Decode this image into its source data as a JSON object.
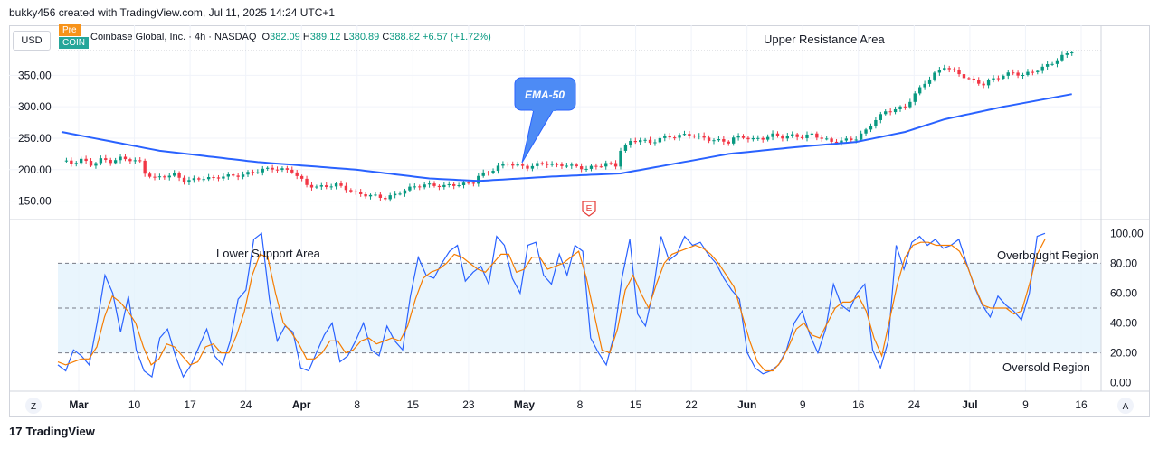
{
  "header": {
    "credit": "bukky456 created with TradingView.com, Jul 11, 2025 14:24 UTC+1"
  },
  "toolbar": {
    "currency": "USD",
    "pre_badge": "Pre",
    "coin_badge": "COIN",
    "scale_z": "Z",
    "scale_a": "A"
  },
  "legend": {
    "name": "Coinbase Global, Inc. · 4h · NASDAQ",
    "o_label": "O",
    "o_value": "382.09",
    "h_label": "H",
    "h_value": "389.12",
    "l_label": "L",
    "l_value": "380.89",
    "c_label": "C",
    "c_value": "388.82",
    "change": "+6.57 (+1.72%)"
  },
  "annotations": {
    "upper_resistance": "Upper Resistance Area",
    "ema_callout": "EMA-50",
    "lower_support": "Lower Support Area",
    "overbought": "Overbought Region",
    "oversold": "Oversold Region",
    "earnings_marker": "E"
  },
  "footer": {
    "brand": "TradingView",
    "logo": "17"
  },
  "colors": {
    "up": "#089981",
    "down": "#f23645",
    "ema": "#2962ff",
    "k_line": "#2962ff",
    "d_line": "#f57c00",
    "band": "#e3f2fd",
    "callout": "#4d8bf5"
  },
  "chart_data": [
    {
      "type": "candlestick",
      "title": "",
      "x_ticks": [
        "Mar",
        "10",
        "17",
        "24",
        "Apr",
        "8",
        "15",
        "23",
        "May",
        "8",
        "15",
        "22",
        "Jun",
        "9",
        "16",
        "24",
        "Jul",
        "9",
        "16"
      ],
      "y_ticks": [
        "150.00",
        "200.00",
        "250.00",
        "300.00",
        "350.00"
      ],
      "ylim": [
        125,
        395
      ],
      "close_series": [
        [
          0,
          214
        ],
        [
          2,
          210
        ],
        [
          4,
          216
        ],
        [
          6,
          208
        ],
        [
          8,
          216
        ],
        [
          10,
          213
        ],
        [
          12,
          218
        ],
        [
          14,
          216
        ],
        [
          16,
          212
        ],
        [
          17,
          195
        ],
        [
          19,
          186
        ],
        [
          21,
          190
        ],
        [
          23,
          192
        ],
        [
          25,
          182
        ],
        [
          27,
          184
        ],
        [
          29,
          187
        ],
        [
          31,
          186
        ],
        [
          33,
          190
        ],
        [
          35,
          190
        ],
        [
          37,
          192
        ],
        [
          39,
          196
        ],
        [
          41,
          200
        ],
        [
          43,
          202
        ],
        [
          45,
          200
        ],
        [
          47,
          198
        ],
        [
          48,
          190
        ],
        [
          50,
          176
        ],
        [
          52,
          172
        ],
        [
          54,
          174
        ],
        [
          56,
          176
        ],
        [
          58,
          170
        ],
        [
          60,
          162
        ],
        [
          62,
          160
        ],
        [
          64,
          158
        ],
        [
          66,
          155
        ],
        [
          68,
          160
        ],
        [
          70,
          168
        ],
        [
          72,
          173
        ],
        [
          74,
          176
        ],
        [
          76,
          175
        ],
        [
          78,
          174
        ],
        [
          80,
          176
        ],
        [
          82,
          177
        ],
        [
          84,
          180
        ],
        [
          85,
          190
        ],
        [
          87,
          196
        ],
        [
          89,
          205
        ],
        [
          91,
          210
        ],
        [
          93,
          206
        ],
        [
          95,
          204
        ],
        [
          97,
          208
        ],
        [
          99,
          210
        ],
        [
          101,
          206
        ],
        [
          103,
          208
        ],
        [
          105,
          204
        ],
        [
          107,
          202
        ],
        [
          109,
          205
        ],
        [
          111,
          210
        ],
        [
          113,
          206
        ],
        [
          114,
          232
        ],
        [
          116,
          244
        ],
        [
          118,
          248
        ],
        [
          120,
          242
        ],
        [
          122,
          250
        ],
        [
          124,
          252
        ],
        [
          126,
          254
        ],
        [
          128,
          256
        ],
        [
          130,
          252
        ],
        [
          132,
          248
        ],
        [
          134,
          246
        ],
        [
          136,
          244
        ],
        [
          137,
          250
        ],
        [
          139,
          252
        ],
        [
          141,
          248
        ],
        [
          143,
          250
        ],
        [
          145,
          255
        ],
        [
          147,
          252
        ],
        [
          149,
          254
        ],
        [
          151,
          252
        ],
        [
          153,
          256
        ],
        [
          155,
          250
        ],
        [
          157,
          244
        ],
        [
          159,
          246
        ],
        [
          161,
          248
        ],
        [
          162,
          250
        ],
        [
          164,
          262
        ],
        [
          166,
          280
        ],
        [
          168,
          292
        ],
        [
          170,
          296
        ],
        [
          172,
          300
        ],
        [
          174,
          320
        ],
        [
          176,
          338
        ],
        [
          178,
          352
        ],
        [
          180,
          364
        ],
        [
          182,
          356
        ],
        [
          184,
          348
        ],
        [
          186,
          340
        ],
        [
          188,
          336
        ],
        [
          190,
          344
        ],
        [
          192,
          350
        ],
        [
          194,
          354
        ],
        [
          196,
          350
        ],
        [
          198,
          356
        ],
        [
          200,
          362
        ],
        [
          202,
          370
        ],
        [
          204,
          380
        ],
        [
          206,
          388.82
        ]
      ],
      "ema50_series": [
        [
          0,
          260
        ],
        [
          20,
          230
        ],
        [
          40,
          212
        ],
        [
          60,
          200
        ],
        [
          75,
          186
        ],
        [
          85,
          182
        ],
        [
          100,
          189
        ],
        [
          114,
          194
        ],
        [
          124,
          208
        ],
        [
          136,
          225
        ],
        [
          150,
          236
        ],
        [
          162,
          244
        ],
        [
          172,
          260
        ],
        [
          180,
          280
        ],
        [
          192,
          300
        ],
        [
          206,
          320
        ]
      ],
      "x_range": [
        0,
        209
      ]
    },
    {
      "type": "line",
      "title": "",
      "y_ticks": [
        "0.00",
        "20.00",
        "40.00",
        "60.00",
        "80.00",
        "100.00"
      ],
      "ylim": [
        -5,
        105
      ],
      "band": [
        20,
        80
      ],
      "midline": 50,
      "series": [
        {
          "name": "",
          "role": "k",
          "values": [
            12,
            8,
            22,
            18,
            12,
            40,
            72,
            60,
            34,
            58,
            22,
            8,
            4,
            30,
            36,
            18,
            4,
            12,
            24,
            36,
            18,
            12,
            28,
            56,
            62,
            96,
            100,
            56,
            28,
            38,
            34,
            10,
            8,
            20,
            32,
            40,
            14,
            18,
            28,
            40,
            22,
            18,
            38,
            28,
            22,
            58,
            84,
            72,
            70,
            80,
            88,
            92,
            68,
            74,
            78,
            66,
            98,
            92,
            70,
            60,
            92,
            94,
            72,
            66,
            86,
            72,
            92,
            88,
            30,
            20,
            12,
            32,
            70,
            96,
            46,
            38,
            62,
            98,
            82,
            86,
            98,
            92,
            94,
            86,
            80,
            70,
            62,
            56,
            20,
            10,
            6,
            8,
            12,
            22,
            40,
            48,
            32,
            20,
            36,
            66,
            52,
            48,
            60,
            66,
            22,
            10,
            28,
            92,
            76,
            94,
            98,
            92,
            96,
            90,
            92,
            96,
            80,
            64,
            52,
            44,
            58,
            52,
            48,
            42,
            60,
            98,
            100
          ]
        },
        {
          "name": "",
          "role": "d",
          "values": [
            14,
            12,
            14,
            16,
            16,
            24,
            44,
            58,
            54,
            48,
            40,
            24,
            12,
            16,
            26,
            24,
            18,
            12,
            14,
            24,
            26,
            20,
            20,
            32,
            48,
            72,
            86,
            84,
            60,
            40,
            34,
            26,
            16,
            16,
            20,
            28,
            28,
            20,
            22,
            28,
            30,
            26,
            28,
            30,
            28,
            38,
            56,
            70,
            74,
            76,
            80,
            86,
            84,
            80,
            76,
            74,
            80,
            86,
            86,
            74,
            76,
            84,
            84,
            76,
            78,
            80,
            84,
            88,
            70,
            46,
            22,
            20,
            36,
            62,
            72,
            60,
            50,
            66,
            80,
            86,
            88,
            90,
            92,
            90,
            86,
            80,
            72,
            64,
            46,
            28,
            14,
            8,
            8,
            14,
            24,
            36,
            40,
            32,
            30,
            40,
            50,
            54,
            54,
            58,
            48,
            30,
            18,
            42,
            66,
            84,
            92,
            94,
            94,
            92,
            92,
            92,
            88,
            78,
            64,
            52,
            50,
            50,
            50,
            46,
            48,
            66,
            86,
            96
          ]
        }
      ]
    }
  ]
}
